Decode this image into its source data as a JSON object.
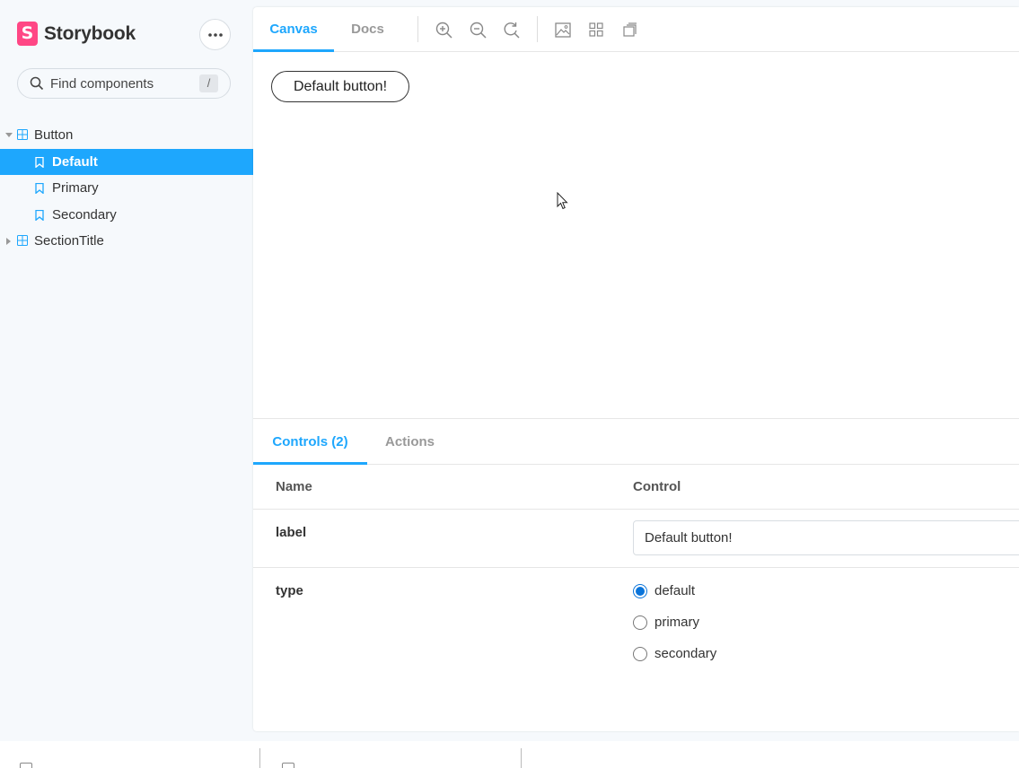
{
  "brand": {
    "logo_letter": "S",
    "name": "Storybook"
  },
  "sidebar": {
    "menu_icon": "ellipsis-icon",
    "search": {
      "placeholder": "Find components",
      "shortcut": "/"
    },
    "tree": [
      {
        "type": "component",
        "label": "Button",
        "expanded": true
      },
      {
        "type": "story",
        "label": "Default",
        "selected": true
      },
      {
        "type": "story",
        "label": "Primary"
      },
      {
        "type": "story",
        "label": "Secondary"
      },
      {
        "type": "component",
        "label": "SectionTitle",
        "expanded": false
      }
    ]
  },
  "toolbar": {
    "tabs": [
      {
        "label": "Canvas",
        "active": true
      },
      {
        "label": "Docs",
        "active": false
      }
    ],
    "icons": [
      "zoom-in-icon",
      "zoom-out-icon",
      "zoom-reset-icon",
      "background-icon",
      "grid-icon",
      "measure-icon"
    ]
  },
  "canvas": {
    "button_label": "Default button!"
  },
  "addons": {
    "tabs": [
      {
        "label": "Controls (2)",
        "active": true
      },
      {
        "label": "Actions",
        "active": false
      }
    ],
    "table": {
      "headers": {
        "name": "Name",
        "control": "Control"
      },
      "label": {
        "name": "label",
        "value": "Default button!"
      },
      "type": {
        "name": "type",
        "options": [
          "default",
          "primary",
          "secondary"
        ],
        "selected": "default"
      }
    }
  },
  "colors": {
    "accent": "#1ea7fd",
    "brand": "#ff4785"
  }
}
